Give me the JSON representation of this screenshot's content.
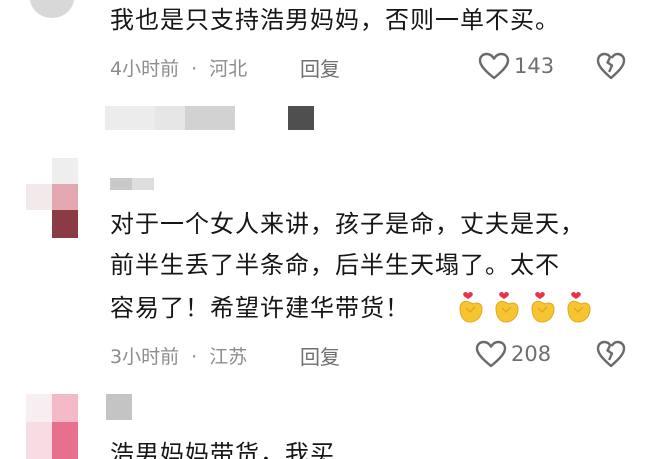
{
  "comments": [
    {
      "text_lines": [
        "我也是只支持浩男妈妈，否则一单不买。"
      ],
      "time": "4小时前",
      "separator": "·",
      "location": "河北",
      "reply_label": "回复",
      "likes": "143"
    },
    {
      "text_lines": [
        "对于一个女人来讲，孩子是命，丈夫是天，",
        "前半生丢了半条命，后半生天塌了。太不",
        "容易了！希望许建华带货！"
      ],
      "emoji": "heart-hands-emoji",
      "emoji_count": 4,
      "time": "3小时前",
      "separator": "·",
      "location": "江苏",
      "reply_label": "回复",
      "likes": "208"
    },
    {
      "text_lines": [
        "浩男妈妈带货，我买"
      ]
    }
  ],
  "icons": {
    "like": "heart-outline-icon",
    "dislike": "broken-heart-icon"
  },
  "colors": {
    "text": "#161616",
    "meta": "#8c8c8c",
    "emoji_yellow": "#f7c531",
    "emoji_heart": "#e8334a"
  }
}
